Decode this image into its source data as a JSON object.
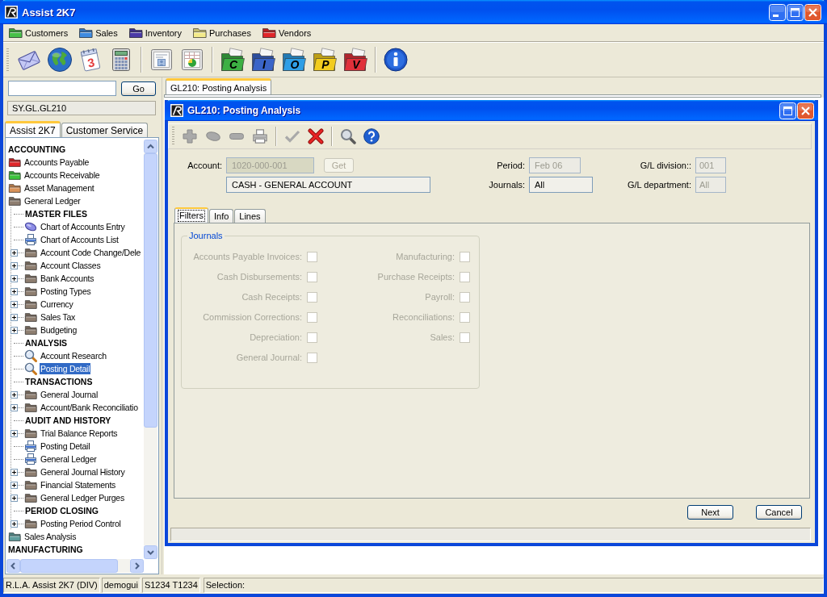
{
  "window": {
    "title": "Assist 2K7"
  },
  "menu": [
    {
      "label": "Customers",
      "color": "#48c048"
    },
    {
      "label": "Sales",
      "color": "#3f8ce0"
    },
    {
      "label": "Inventory",
      "color": "#4b3aa6"
    },
    {
      "label": "Purchases",
      "color": "#f2ea8a"
    },
    {
      "label": "Vendors",
      "color": "#e0262a"
    }
  ],
  "toolbar": [
    {
      "kind": "envelope"
    },
    {
      "kind": "globe"
    },
    {
      "kind": "calendar",
      "label": "3"
    },
    {
      "kind": "calculator"
    },
    {
      "kind": "separator"
    },
    {
      "kind": "card"
    },
    {
      "kind": "sheet"
    },
    {
      "kind": "separator"
    },
    {
      "kind": "folder",
      "label": "C",
      "color": "#3cb043"
    },
    {
      "kind": "folder",
      "label": "I",
      "color": "#3a64c8"
    },
    {
      "kind": "folder",
      "label": "O",
      "color": "#2e9ee6"
    },
    {
      "kind": "folder",
      "label": "P",
      "color": "#f2cc1e"
    },
    {
      "kind": "folder",
      "label": "V",
      "color": "#e0303a"
    },
    {
      "kind": "separator"
    },
    {
      "kind": "info"
    }
  ],
  "sidebar": {
    "go_button": "Go",
    "path": "SY.GL.GL210",
    "tabs": [
      {
        "label": "Assist 2K7",
        "selected": true
      },
      {
        "label": "Customer Service",
        "selected": false
      }
    ],
    "tree": [
      {
        "label": "ACCOUNTING",
        "kind": "header",
        "selected": false
      },
      {
        "label": "Accounts Payable",
        "kind": "folder",
        "color": "#e0262a",
        "selected": false
      },
      {
        "label": "Accounts Receivable",
        "kind": "folder",
        "color": "#3cc43c",
        "selected": false
      },
      {
        "label": "Asset Management",
        "kind": "folder",
        "color": "#d9935a",
        "selected": false
      },
      {
        "label": "General Ledger",
        "kind": "folder",
        "color": "#8e7e70",
        "selected": false,
        "children": [
          {
            "label": "MASTER FILES",
            "kind": "header",
            "selected": false
          },
          {
            "label": "Chart of Accounts Entry",
            "kind": "oval",
            "selected": false
          },
          {
            "label": "Chart of Accounts List",
            "kind": "printer",
            "selected": false
          },
          {
            "label": "Account Code Change/Dele",
            "kind": "folder",
            "expanded": false,
            "selected": false
          },
          {
            "label": "Account Classes",
            "kind": "folder",
            "expanded": false,
            "selected": false
          },
          {
            "label": "Bank Accounts",
            "kind": "folder",
            "expanded": false,
            "selected": false
          },
          {
            "label": "Posting Types",
            "kind": "folder",
            "expanded": false,
            "selected": false
          },
          {
            "label": "Currency",
            "kind": "folder",
            "expanded": false,
            "selected": false
          },
          {
            "label": "Sales Tax",
            "kind": "folder",
            "expanded": false,
            "selected": false
          },
          {
            "label": "Budgeting",
            "kind": "folder",
            "expanded": false,
            "selected": false
          },
          {
            "label": "ANALYSIS",
            "kind": "header",
            "selected": false
          },
          {
            "label": "Account Research",
            "kind": "magnifier",
            "selected": false
          },
          {
            "label": "Posting Detail",
            "kind": "magnifier",
            "selected": true
          },
          {
            "label": "TRANSACTIONS",
            "kind": "header",
            "selected": false
          },
          {
            "label": "General Journal",
            "kind": "folder",
            "expanded": false,
            "selected": false
          },
          {
            "label": "Account/Bank Reconciliatio",
            "kind": "folder",
            "expanded": false,
            "selected": false
          },
          {
            "label": "AUDIT AND HISTORY",
            "kind": "header",
            "selected": false
          },
          {
            "label": "Trial Balance Reports",
            "kind": "folder",
            "expanded": false,
            "selected": false
          },
          {
            "label": "Posting Detail",
            "kind": "printer",
            "selected": false
          },
          {
            "label": "General Ledger",
            "kind": "printer",
            "selected": false
          },
          {
            "label": "General Journal History",
            "kind": "folder",
            "expanded": false,
            "selected": false
          },
          {
            "label": "Financial Statements",
            "kind": "folder",
            "expanded": false,
            "selected": false
          },
          {
            "label": "General Ledger Purges",
            "kind": "folder",
            "expanded": false,
            "selected": false
          },
          {
            "label": "PERIOD CLOSING",
            "kind": "header",
            "selected": false
          },
          {
            "label": "Posting Period Control",
            "kind": "folder",
            "expanded": false,
            "selected": false
          }
        ]
      },
      {
        "label": "Sales Analysis",
        "kind": "folder",
        "color": "#5f9e9e",
        "selected": false
      },
      {
        "label": "MANUFACTURING",
        "kind": "header",
        "selected": false
      }
    ]
  },
  "document_tabs": [
    {
      "label": "GL210: Posting Analysis",
      "selected": true
    }
  ],
  "dialog": {
    "title": "GL210: Posting Analysis",
    "toolbar": [
      {
        "kind": "add",
        "disabled": true
      },
      {
        "kind": "oval",
        "disabled": true
      },
      {
        "kind": "bar",
        "disabled": true
      },
      {
        "kind": "printer",
        "disabled": true
      },
      {
        "kind": "separator"
      },
      {
        "kind": "check",
        "disabled": true
      },
      {
        "kind": "cancel",
        "disabled": false
      },
      {
        "kind": "separator"
      },
      {
        "kind": "search",
        "disabled": false
      },
      {
        "kind": "help",
        "disabled": false
      }
    ],
    "account": {
      "label": "Account:",
      "value": "1020-000-001",
      "disabled": true
    },
    "get_button": {
      "label": "Get",
      "disabled": true
    },
    "account_name": {
      "value": "CASH - GENERAL ACCOUNT",
      "disabled": false
    },
    "period": {
      "label": "Period:",
      "value": "Feb 06",
      "disabled": true
    },
    "journals": {
      "label": "Journals:",
      "value": "All",
      "disabled": false
    },
    "gl_division": {
      "label": "G/L division::",
      "value": "001",
      "disabled": true
    },
    "gl_department": {
      "label": "G/L department:",
      "value": "All",
      "disabled": true
    },
    "tabs": [
      {
        "label": "Filters",
        "selected": true
      },
      {
        "label": "Info",
        "selected": false
      },
      {
        "label": "Lines",
        "selected": false
      }
    ],
    "journal_group": {
      "title": "Journals",
      "options": [
        {
          "label": "Accounts Payable Invoices:",
          "checked": false,
          "disabled": true
        },
        {
          "label": "Manufacturing:",
          "checked": false,
          "disabled": true
        },
        {
          "label": "Cash Disbursements:",
          "checked": false,
          "disabled": true
        },
        {
          "label": "Purchase Receipts:",
          "checked": false,
          "disabled": true
        },
        {
          "label": "Cash Receipts:",
          "checked": false,
          "disabled": true
        },
        {
          "label": "Payroll:",
          "checked": false,
          "disabled": true
        },
        {
          "label": "Commission Corrections:",
          "checked": false,
          "disabled": true
        },
        {
          "label": "Reconciliations:",
          "checked": false,
          "disabled": true
        },
        {
          "label": "Depreciation:",
          "checked": false,
          "disabled": true
        },
        {
          "label": "Sales:",
          "checked": false,
          "disabled": true
        },
        {
          "label": "General Journal:",
          "checked": false,
          "disabled": true
        }
      ]
    },
    "buttons": [
      {
        "label": "Next"
      },
      {
        "label": "Cancel"
      }
    ]
  },
  "status_bar": [
    "R.L.A. Assist 2K7 (DIV)",
    "demogui",
    "S1234 T1234",
    "Selection:"
  ]
}
